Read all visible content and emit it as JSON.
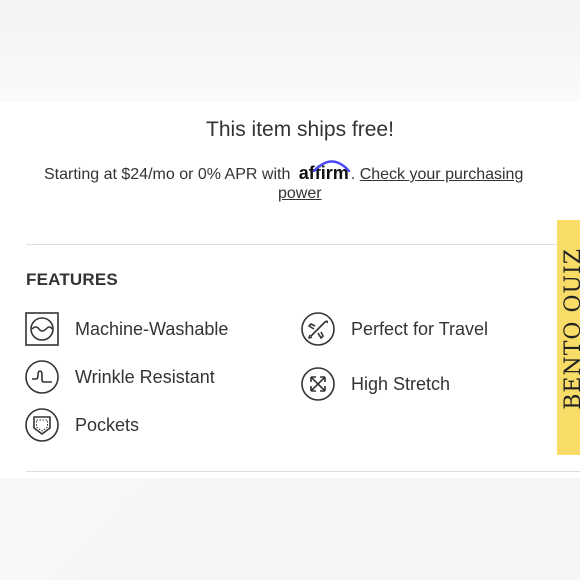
{
  "shipping": {
    "title": "This item ships free!"
  },
  "financing": {
    "prefix": "Starting at $24/mo or 0% APR with",
    "brand": "affirm",
    "link_part1": "Check your purchasing",
    "link_part2": "power"
  },
  "features": {
    "heading": "FEATURES",
    "items": [
      {
        "label": "Machine-Washable",
        "icon": "washing-machine-icon"
      },
      {
        "label": "Perfect for Travel",
        "icon": "airplane-icon"
      },
      {
        "label": "Wrinkle Resistant",
        "icon": "wrinkle-icon"
      },
      {
        "label": "High Stretch",
        "icon": "stretch-arrows-icon"
      },
      {
        "label": "Pockets",
        "icon": "pocket-icon"
      }
    ]
  },
  "quiz_tab": {
    "label": "BENTO QUIZ"
  },
  "colors": {
    "quiz_bg": "#f9dc68",
    "affirm_arc": "#4a4af4",
    "text": "#333333"
  }
}
